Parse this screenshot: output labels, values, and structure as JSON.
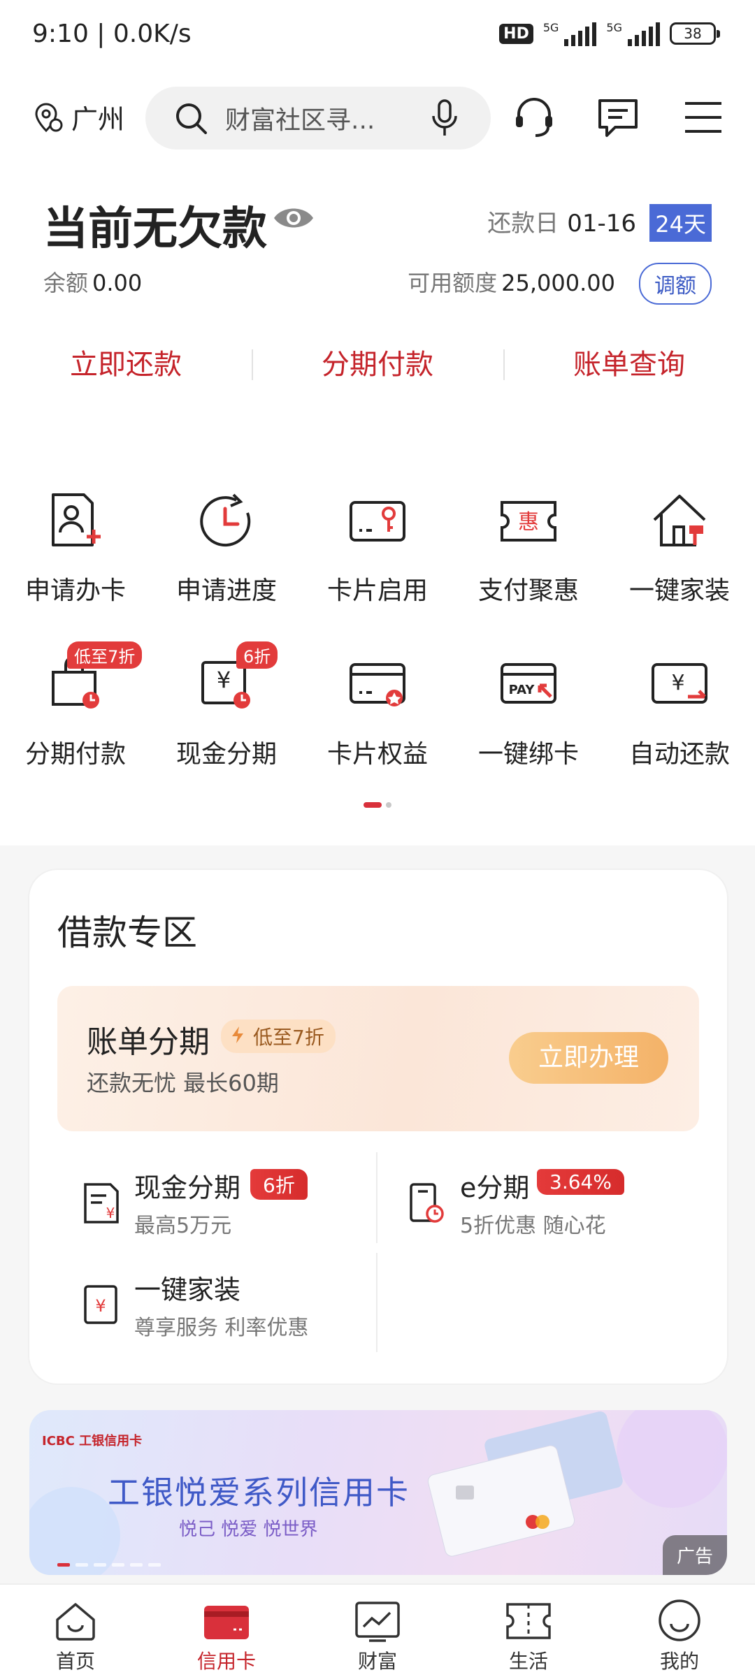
{
  "status_bar": {
    "time": "9:10 | 0.0K/s",
    "hd": "HD",
    "network": "5G",
    "battery": "38"
  },
  "top_bar": {
    "location": "广州",
    "search_placeholder": "财富社区寻..."
  },
  "summary": {
    "debt_status": "当前无欠款",
    "repay_day_label": "还款日",
    "repay_day": "01-16",
    "days_left": "24天",
    "balance_label": "余额",
    "balance": "0.00",
    "credit_label": "可用额度",
    "credit": "25,000.00",
    "adjust_label": "调额",
    "actions": [
      "立即还款",
      "分期付款",
      "账单查询"
    ]
  },
  "services": {
    "row1": [
      {
        "label": "申请办卡",
        "icon": "apply-card-icon"
      },
      {
        "label": "申请进度",
        "icon": "progress-icon"
      },
      {
        "label": "卡片启用",
        "icon": "card-activate-icon"
      },
      {
        "label": "支付聚惠",
        "icon": "payment-deals-icon"
      },
      {
        "label": "一键家装",
        "icon": "home-decor-icon"
      }
    ],
    "row2": [
      {
        "label": "分期付款",
        "icon": "installment-icon",
        "tag": "低至7折"
      },
      {
        "label": "现金分期",
        "icon": "cash-installment-icon",
        "tag": "6折"
      },
      {
        "label": "卡片权益",
        "icon": "card-benefits-icon"
      },
      {
        "label": "一键绑卡",
        "icon": "bind-card-icon"
      },
      {
        "label": "自动还款",
        "icon": "auto-repay-icon"
      }
    ]
  },
  "loan_zone": {
    "title": "借款专区",
    "bill": {
      "title": "账单分期",
      "tag": "低至7折",
      "subtitle": "还款无忧 最长60期",
      "button": "立即办理"
    },
    "items": [
      {
        "name": "现金分期",
        "badge": "6折",
        "sub": "最高5万元"
      },
      {
        "name": "e分期",
        "badge": "3.64%",
        "sub": "5折优惠 随心花"
      },
      {
        "name": "一键家装",
        "sub": "尊享服务 利率优惠"
      }
    ]
  },
  "banner": {
    "brand": "ICBC 工银信用卡",
    "title": "工银悦爱系列信用卡",
    "subtitle": "悦己 悦爱 悦世界",
    "ad_label": "广告"
  },
  "bottom_nav": [
    "首页",
    "信用卡",
    "财富",
    "生活",
    "我的"
  ],
  "colors": {
    "brand_red": "#c5242b",
    "accent_blue": "#4a6ad6",
    "orange": "#f4b268"
  }
}
